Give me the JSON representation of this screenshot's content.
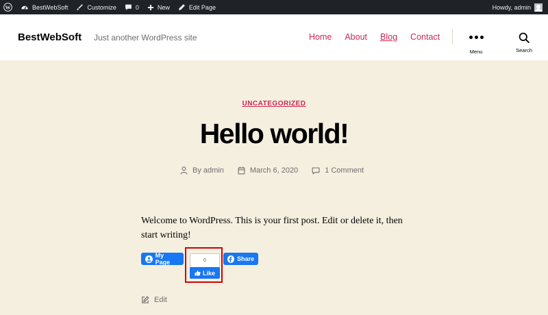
{
  "adminbar": {
    "site_name": "BestWebSoft",
    "customize": "Customize",
    "comments_count": "0",
    "new": "New",
    "edit_page": "Edit Page",
    "greeting": "Howdy, admin"
  },
  "header": {
    "site_title": "BestWebSoft",
    "tagline": "Just another WordPress site",
    "nav": [
      {
        "label": "Home"
      },
      {
        "label": "About"
      },
      {
        "label": "Blog",
        "current": true
      },
      {
        "label": "Contact"
      }
    ],
    "menu_label": "Menu",
    "search_label": "Search"
  },
  "post": {
    "category": "UNCATEGORIZED",
    "title": "Hello world!",
    "author": "By admin",
    "date": "March 6, 2020",
    "comments": "1 Comment",
    "body": "Welcome to WordPress. This is your first post. Edit or delete it, then start writing!"
  },
  "facebook": {
    "my_page": "My Page",
    "like_count": "0",
    "like": "Like",
    "share": "Share",
    "color": "#1877f2"
  },
  "edit_label": "Edit",
  "colors": {
    "accent": "#cd2653",
    "background": "#f5efe0",
    "adminbar": "#1d2327",
    "highlight_border": "#d40000"
  }
}
